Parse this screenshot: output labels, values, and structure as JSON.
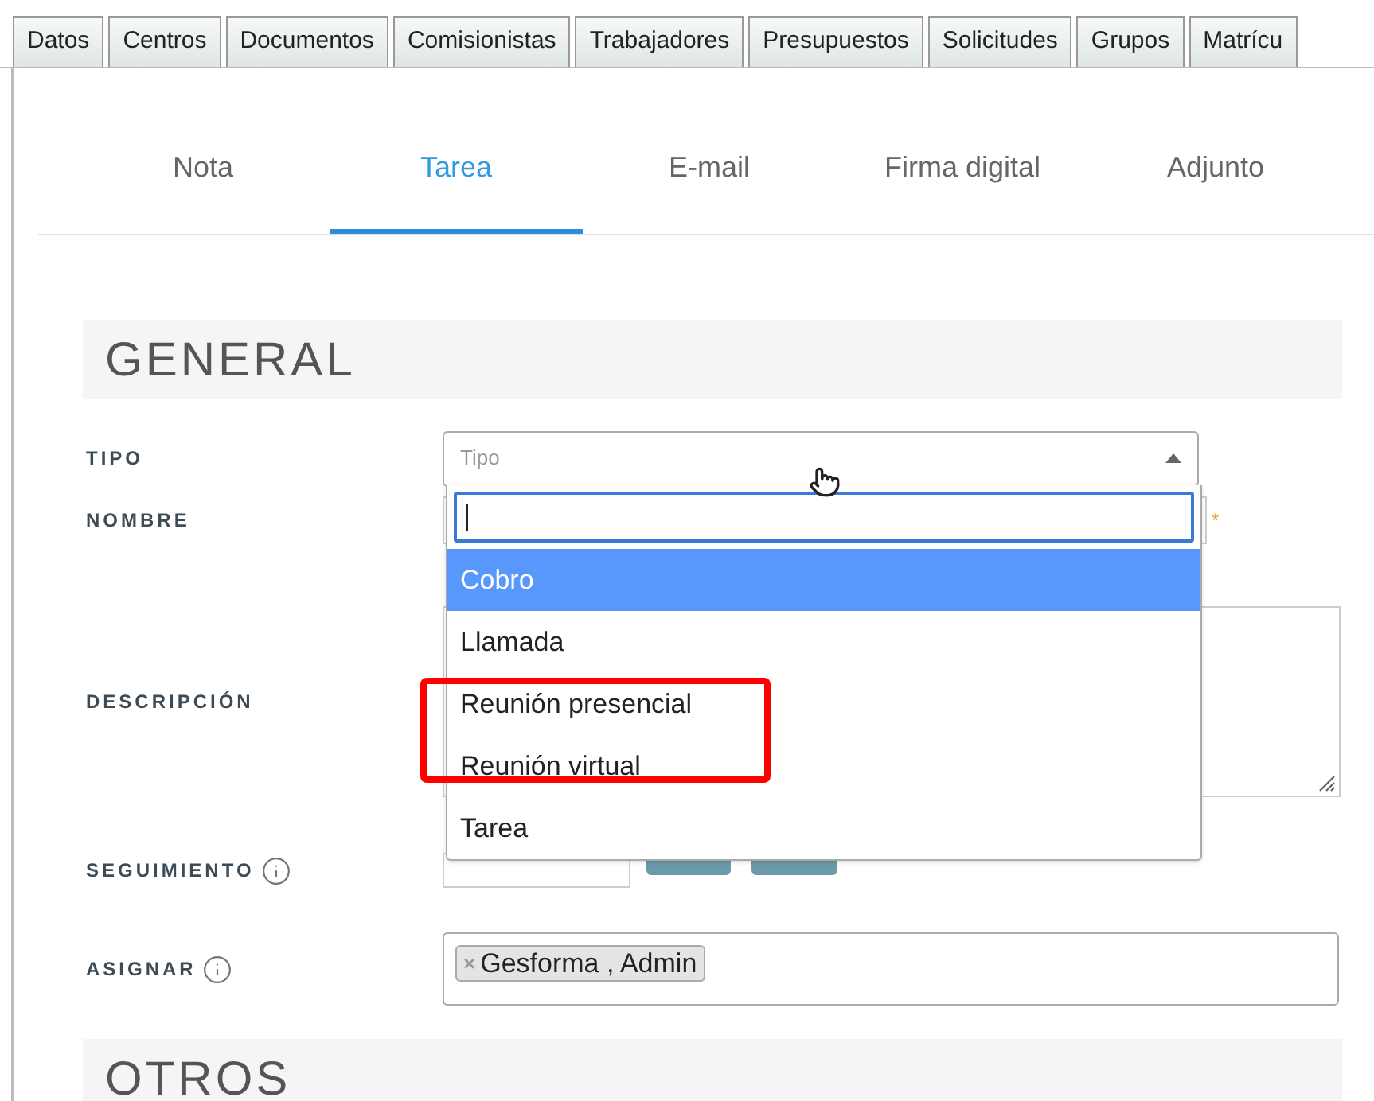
{
  "top_tabs": [
    {
      "label": "Datos",
      "selected": false
    },
    {
      "label": "Centros",
      "selected": false
    },
    {
      "label": "Documentos",
      "selected": false
    },
    {
      "label": "Comisionistas",
      "selected": false
    },
    {
      "label": "Trabajadores",
      "selected": false
    },
    {
      "label": "Presupuestos",
      "selected": false
    },
    {
      "label": "Solicitudes",
      "selected": false
    },
    {
      "label": "Grupos",
      "selected": false
    },
    {
      "label": "Matrícu",
      "selected": false
    }
  ],
  "sub_tabs": [
    {
      "label": "Nota",
      "selected": false
    },
    {
      "label": "Tarea",
      "selected": true
    },
    {
      "label": "E-mail",
      "selected": false
    },
    {
      "label": "Firma digital",
      "selected": false
    },
    {
      "label": "Adjunto",
      "selected": false
    }
  ],
  "general": {
    "title": "GENERAL"
  },
  "fields": {
    "tipo": {
      "label": "TIPO",
      "placeholder": "Tipo",
      "expanded": true
    },
    "nombre": {
      "label": "NOMBRE",
      "required_mark": "*"
    },
    "descripcion": {
      "label": "DESCRIPCIÓN"
    },
    "seguimiento": {
      "label": "SEGUIMIENTO",
      "info": true
    },
    "asignar": {
      "label": "ASIGNAR",
      "info": true,
      "tags": [
        {
          "label": "Gesforma , Admin",
          "remove": "×"
        }
      ]
    }
  },
  "dropdown": {
    "options": [
      {
        "label": "Cobro",
        "selected": true,
        "marked": false
      },
      {
        "label": "Llamada",
        "selected": false,
        "marked": false
      },
      {
        "label": "Reunión presencial",
        "selected": false,
        "marked": true
      },
      {
        "label": "Reunión virtual",
        "selected": false,
        "marked": true
      },
      {
        "label": "Tarea",
        "selected": false,
        "marked": false
      }
    ]
  },
  "otros": {
    "title": "OTROS"
  }
}
